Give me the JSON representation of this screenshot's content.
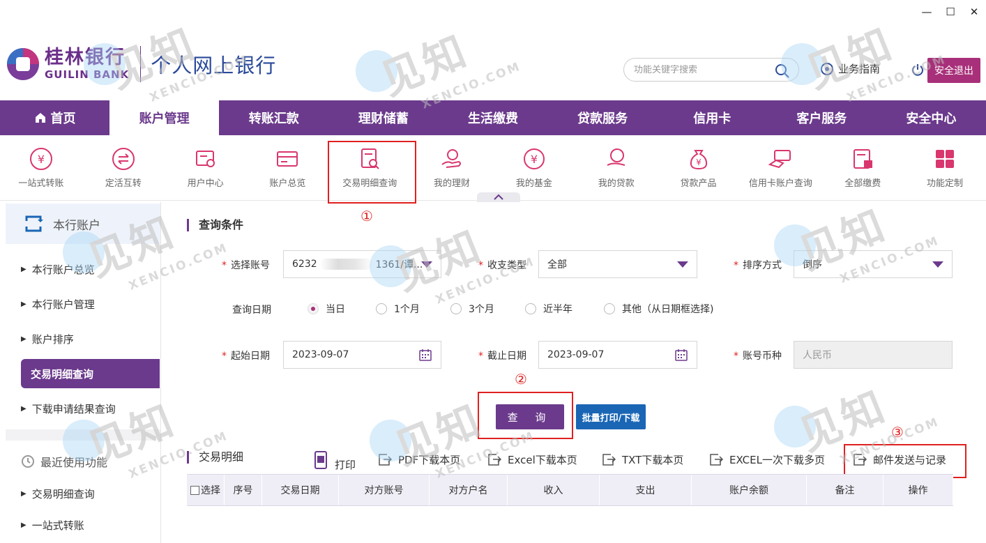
{
  "window": {
    "minimize": "—",
    "maximize": "☐",
    "close": "✕"
  },
  "brand": {
    "name_cn": "桂林银行",
    "name_en": "GUILIN BANK",
    "product": "个人网上银行"
  },
  "header": {
    "search_placeholder": "功能关键字搜索",
    "guide_label": "业务指南",
    "logout_label": "安全退出"
  },
  "nav": {
    "items": [
      "首页",
      "账户管理",
      "转账汇款",
      "理财储蓄",
      "生活缴费",
      "贷款服务",
      "信用卡",
      "客户服务",
      "安全中心"
    ],
    "active": "账户管理"
  },
  "subnav": {
    "items": [
      "一站式转账",
      "定活互转",
      "用户中心",
      "账户总览",
      "交易明细查询",
      "我的理财",
      "我的基金",
      "我的贷款",
      "贷款产品",
      "信用卡账户查询",
      "全部缴费",
      "功能定制"
    ]
  },
  "annotations": {
    "n1": "①",
    "n2": "②",
    "n3": "③"
  },
  "sidebar": {
    "header": "本行账户",
    "items": [
      "本行账户总览",
      "本行账户管理",
      "账户排序",
      "交易明细查询",
      "下载申请结果查询"
    ],
    "active": "交易明细查询",
    "recent_header": "最近使用功能",
    "recent_items": [
      "交易明细查询",
      "一站式转账"
    ]
  },
  "query": {
    "section_title": "查询条件",
    "account_label": "选择账号",
    "account_prefix": "6232",
    "account_suffix": "1361/谭...",
    "type_label": "收支类型",
    "type_value": "全部",
    "sort_label": "排序方式",
    "sort_value": "倒序",
    "date_label": "查询日期",
    "date_options": [
      "当日",
      "1个月",
      "3个月",
      "近半年",
      "其他（从日期框选择)"
    ],
    "date_selected": "当日",
    "start_label": "起始日期",
    "start_value": "2023-09-07",
    "end_label": "截止日期",
    "end_value": "2023-09-07",
    "currency_label": "账号币种",
    "currency_value": "人民币",
    "query_button": "查 询",
    "batch_button": "批量打印/下载"
  },
  "details": {
    "section_title": "交易明细",
    "tools": [
      "打印",
      "PDF下载本页",
      "Excel下载本页",
      "TXT下载本页",
      "EXCEL一次下载多页",
      "邮件发送与记录"
    ],
    "columns": [
      "选择",
      "序号",
      "交易日期",
      "对方账号",
      "对方户名",
      "收入",
      "支出",
      "账户余额",
      "备注",
      "操作"
    ]
  },
  "watermark": {
    "cn": "见知",
    "en": "XENCIO.COM"
  }
}
